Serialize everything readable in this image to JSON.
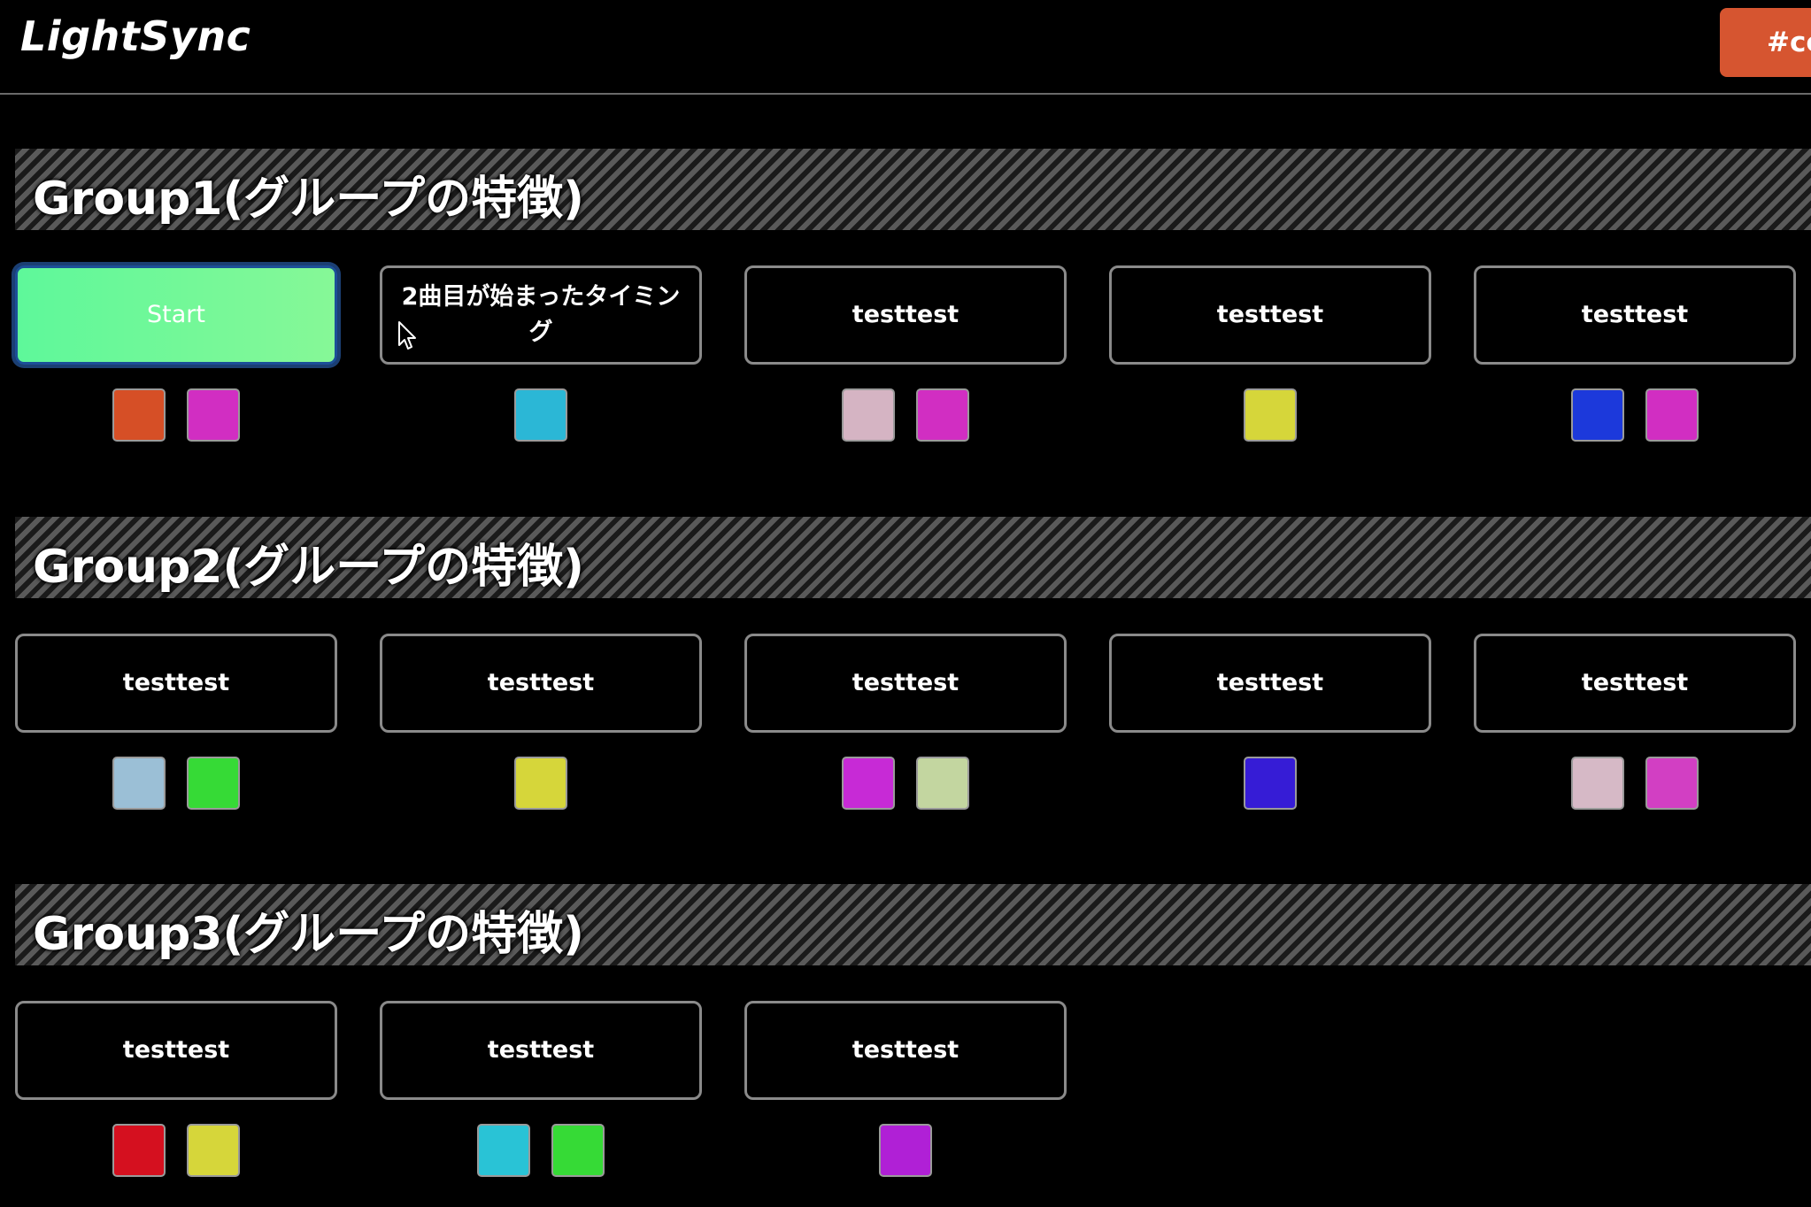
{
  "app": {
    "title": "LightSync",
    "channel_button_label": "#cc"
  },
  "groups": [
    {
      "title": "Group1(グループの特徴)",
      "items": [
        {
          "label": "Start",
          "active": true,
          "colors": [
            "#d64f26",
            "#d12ec2"
          ]
        },
        {
          "label": "2曲目が始まったタイミング",
          "active": false,
          "colors": [
            "#2bb7d6"
          ]
        },
        {
          "label": "testtest",
          "active": false,
          "colors": [
            "#d5b4c3",
            "#d12ec2"
          ]
        },
        {
          "label": "testtest",
          "active": false,
          "colors": [
            "#d6d63a"
          ]
        },
        {
          "label": "testtest",
          "active": false,
          "colors": [
            "#1c39db",
            "#d12ec2"
          ]
        }
      ]
    },
    {
      "title": "Group2(グループの特徴)",
      "items": [
        {
          "label": "testtest",
          "active": false,
          "colors": [
            "#9bbfd6",
            "#36da36"
          ]
        },
        {
          "label": "testtest",
          "active": false,
          "colors": [
            "#d6d63a"
          ]
        },
        {
          "label": "testtest",
          "active": false,
          "colors": [
            "#c72ad6",
            "#c3d6a0"
          ]
        },
        {
          "label": "testtest",
          "active": false,
          "colors": [
            "#361cd6"
          ]
        },
        {
          "label": "testtest",
          "active": false,
          "colors": [
            "#d6b9c6",
            "#d23fc3"
          ]
        }
      ]
    },
    {
      "title": "Group3(グループの特徴)",
      "items": [
        {
          "label": "testtest",
          "active": false,
          "colors": [
            "#d5101f",
            "#d6d63a"
          ]
        },
        {
          "label": "testtest",
          "active": false,
          "colors": [
            "#29c3d6",
            "#36da36"
          ]
        },
        {
          "label": "testtest",
          "active": false,
          "colors": [
            "#b020d6"
          ]
        }
      ]
    }
  ]
}
